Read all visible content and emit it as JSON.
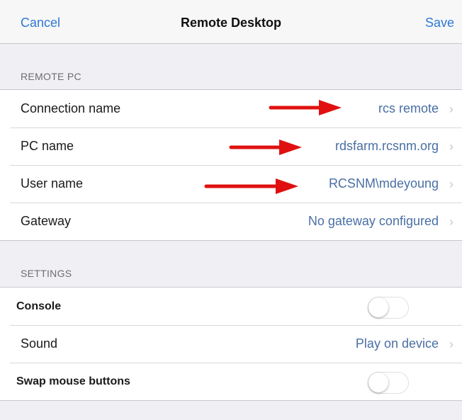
{
  "navbar": {
    "cancel_label": "Cancel",
    "title": "Remote Desktop",
    "save_label": "Save"
  },
  "remote_pc": {
    "header": "REMOTE PC",
    "rows": [
      {
        "label": "Connection name",
        "value": "rcs remote"
      },
      {
        "label": "PC name",
        "value": "rdsfarm.rcsnm.org"
      },
      {
        "label": "User name",
        "value": "RCSNM\\mdeyoung"
      },
      {
        "label": "Gateway",
        "value": "No gateway configured"
      }
    ]
  },
  "settings": {
    "header": "SETTINGS",
    "console_label": "Console",
    "console_on": false,
    "sound_label": "Sound",
    "sound_value": "Play on device",
    "swap_label": "Swap mouse buttons",
    "swap_on": false
  },
  "colors": {
    "accent": "#2e78d6",
    "value_text": "#4a6fa5",
    "annotation_arrow": "#e01010",
    "background": "#efeff4"
  },
  "icons": {
    "chevron": "chevron-right-icon",
    "annotation": "red-arrow-icon"
  }
}
